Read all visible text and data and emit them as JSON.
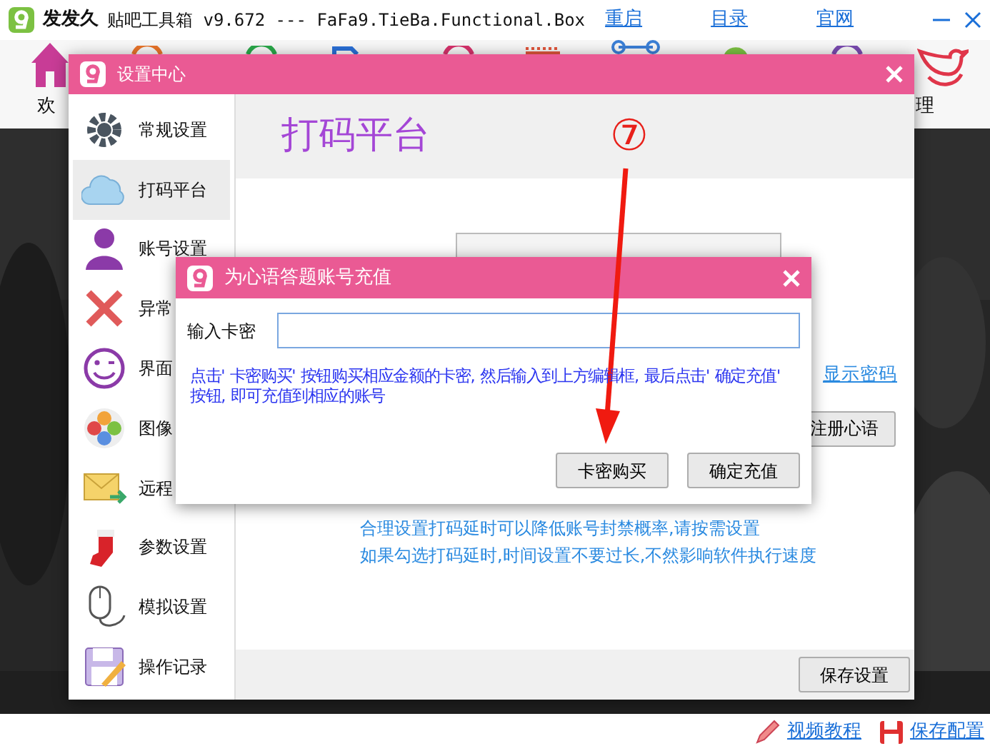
{
  "app": {
    "brand": "发发久",
    "title": "贴吧工具箱 v9.672 --- FaFa9.TieBa.Functional.Box",
    "links": [
      "重启",
      "目录",
      "官网"
    ],
    "toolbar": [
      "欢",
      "理"
    ]
  },
  "settings": {
    "title": "设置中心",
    "sidebar": [
      {
        "label": "常规设置",
        "selected": false
      },
      {
        "label": "打码平台",
        "selected": true
      },
      {
        "label": "账号设置",
        "selected": false
      },
      {
        "label": "异常",
        "selected": false
      },
      {
        "label": "界面",
        "selected": false
      },
      {
        "label": "图像",
        "selected": false
      },
      {
        "label": "远程",
        "selected": false
      },
      {
        "label": "参数设置",
        "selected": false
      },
      {
        "label": "模拟设置",
        "selected": false
      },
      {
        "label": "操作记录",
        "selected": false
      }
    ],
    "heading": "打码平台",
    "show_password": "显示密码",
    "register_button": "注册心语",
    "notes": [
      "合理设置打码延时可以降低账号封禁概率,请按需设置",
      "如果勾选打码延时,时间设置不要过长,不然影响软件执行速度"
    ],
    "save_button": "保存设置"
  },
  "dialog": {
    "title": "为心语答题账号充值",
    "field_label": "输入卡密",
    "hint": "点击' 卡密购买' 按钮购买相应金额的卡密, 然后输入到上方编辑框, 最后点击' 确定充值' 按钮, 即可充值到相应的账号",
    "buttons": [
      "卡密购买",
      "确定充值"
    ]
  },
  "annotation": {
    "marker": "⑦"
  },
  "footer": {
    "links": [
      "视频教程",
      "保存配置"
    ]
  }
}
